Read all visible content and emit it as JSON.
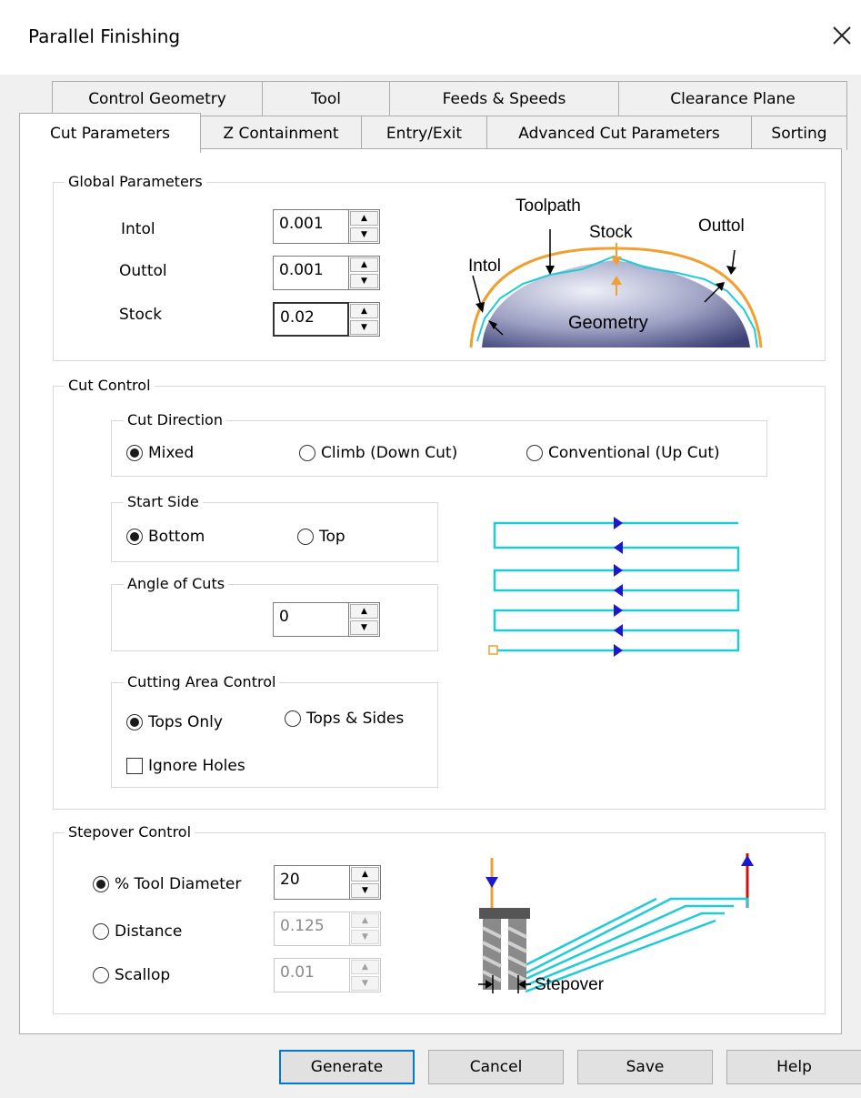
{
  "window": {
    "title": "Parallel Finishing",
    "close_icon": "close-icon"
  },
  "tabs_row1": [
    "Control Geometry",
    "Tool",
    "Feeds & Speeds",
    "Clearance Plane"
  ],
  "tabs_row2": [
    "Cut Parameters",
    "Z Containment",
    "Entry/Exit",
    "Advanced Cut Parameters",
    "Sorting"
  ],
  "active_tab": "Cut Parameters",
  "global": {
    "group_label": "Global Parameters",
    "intol_label": "Intol",
    "intol_value": "0.001",
    "outtol_label": "Outtol",
    "outtol_value": "0.001",
    "stock_label": "Stock",
    "stock_value": "0.02",
    "diagram": {
      "toolpath": "Toolpath",
      "stock": "Stock",
      "outtol": "Outtol",
      "intol": "Intol",
      "geometry": "Geometry"
    }
  },
  "cut_control": {
    "group_label": "Cut Control",
    "direction": {
      "label": "Cut Direction",
      "options": [
        "Mixed",
        "Climb (Down Cut)",
        "Conventional (Up Cut)"
      ],
      "selected": "Mixed"
    },
    "start_side": {
      "label": "Start Side",
      "options": [
        "Bottom",
        "Top"
      ],
      "selected": "Bottom"
    },
    "angle": {
      "label": "Angle of Cuts",
      "value": "0"
    },
    "area": {
      "label": "Cutting Area Control",
      "options": [
        "Tops Only",
        "Tops & Sides"
      ],
      "selected": "Tops Only",
      "ignore_holes_label": "Ignore Holes",
      "ignore_holes_checked": false
    }
  },
  "stepover": {
    "group_label": "Stepover Control",
    "options": [
      "% Tool Diameter",
      "Distance",
      "Scallop"
    ],
    "selected": "% Tool Diameter",
    "tool_diameter_value": "20",
    "distance_value": "0.125",
    "scallop_value": "0.01",
    "diagram_label": "Stepover"
  },
  "buttons": {
    "generate": "Generate",
    "cancel": "Cancel",
    "save": "Save",
    "help": "Help"
  },
  "colors": {
    "toolpath": "#1ecbd6",
    "stock": "#f0a030",
    "arrow_blue": "#1a1acc",
    "plunge_red": "#d01010"
  }
}
